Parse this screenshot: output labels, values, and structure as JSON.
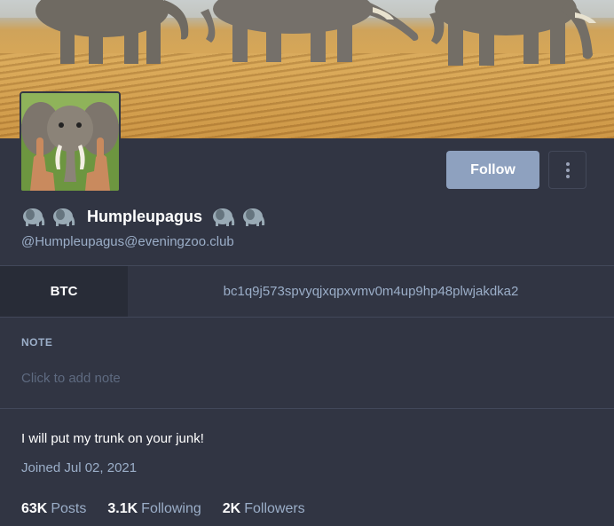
{
  "header": {
    "banner_image": "elephants-walking-savanna"
  },
  "profile": {
    "avatar_image": "elephant-avatar",
    "name_prefix_emoji": [
      "elephant-emoji",
      "elephant-emoji"
    ],
    "display_name": "Humpleupagus",
    "name_suffix_emoji": [
      "elephant-emoji",
      "elephant-emoji"
    ],
    "handle": "@Humpleupagus@eveningzoo.club"
  },
  "actions": {
    "follow_label": "Follow",
    "more_icon": "vertical-ellipsis-icon"
  },
  "fields": [
    {
      "key": "BTC",
      "value": "bc1q9j573spvyqjxqpxvmv0m4up9hp48plwjakdka2"
    }
  ],
  "note": {
    "label": "NOTE",
    "placeholder": "Click to add note"
  },
  "bio": {
    "text": "I will put my trunk on your junk!",
    "joined": "Joined Jul 02, 2021"
  },
  "counts": {
    "posts_value": "63K",
    "posts_label": "Posts",
    "following_value": "3.1K",
    "following_label": "Following",
    "followers_value": "2K",
    "followers_label": "Followers"
  },
  "colors": {
    "background": "#313543",
    "accent": "#8ea1bf",
    "muted_text": "#9baec8",
    "field_key_bg": "#282c37"
  }
}
